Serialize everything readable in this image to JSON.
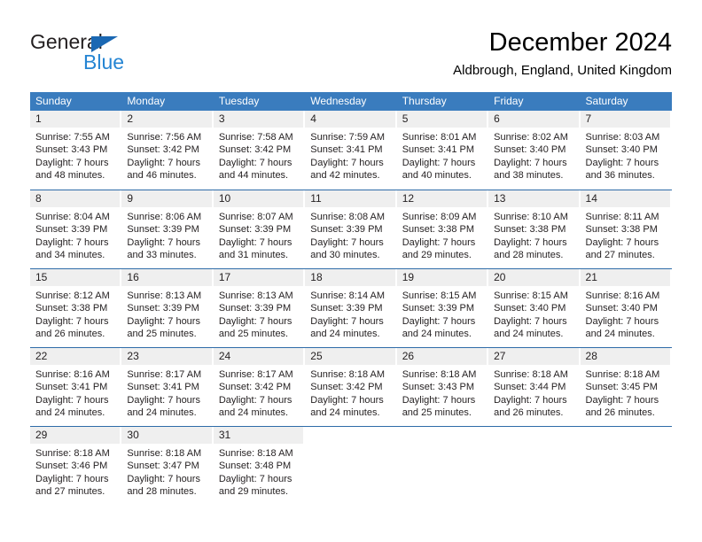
{
  "brand": {
    "name_top": "General",
    "name_bottom": "Blue",
    "color_dark": "#231f20",
    "color_blue": "#2585d3",
    "triangle_color": "#1b68b3"
  },
  "header": {
    "title": "December 2024",
    "location": "Aldbrough, England, United Kingdom"
  },
  "calendar": {
    "header_bg": "#3a7cbe",
    "day_band_bg": "#efefef",
    "weekdays": [
      "Sunday",
      "Monday",
      "Tuesday",
      "Wednesday",
      "Thursday",
      "Friday",
      "Saturday"
    ],
    "weeks": [
      [
        {
          "day": "1",
          "sunrise": "Sunrise: 7:55 AM",
          "sunset": "Sunset: 3:43 PM",
          "daylight_line1": "Daylight: 7 hours",
          "daylight_line2": "and 48 minutes."
        },
        {
          "day": "2",
          "sunrise": "Sunrise: 7:56 AM",
          "sunset": "Sunset: 3:42 PM",
          "daylight_line1": "Daylight: 7 hours",
          "daylight_line2": "and 46 minutes."
        },
        {
          "day": "3",
          "sunrise": "Sunrise: 7:58 AM",
          "sunset": "Sunset: 3:42 PM",
          "daylight_line1": "Daylight: 7 hours",
          "daylight_line2": "and 44 minutes."
        },
        {
          "day": "4",
          "sunrise": "Sunrise: 7:59 AM",
          "sunset": "Sunset: 3:41 PM",
          "daylight_line1": "Daylight: 7 hours",
          "daylight_line2": "and 42 minutes."
        },
        {
          "day": "5",
          "sunrise": "Sunrise: 8:01 AM",
          "sunset": "Sunset: 3:41 PM",
          "daylight_line1": "Daylight: 7 hours",
          "daylight_line2": "and 40 minutes."
        },
        {
          "day": "6",
          "sunrise": "Sunrise: 8:02 AM",
          "sunset": "Sunset: 3:40 PM",
          "daylight_line1": "Daylight: 7 hours",
          "daylight_line2": "and 38 minutes."
        },
        {
          "day": "7",
          "sunrise": "Sunrise: 8:03 AM",
          "sunset": "Sunset: 3:40 PM",
          "daylight_line1": "Daylight: 7 hours",
          "daylight_line2": "and 36 minutes."
        }
      ],
      [
        {
          "day": "8",
          "sunrise": "Sunrise: 8:04 AM",
          "sunset": "Sunset: 3:39 PM",
          "daylight_line1": "Daylight: 7 hours",
          "daylight_line2": "and 34 minutes."
        },
        {
          "day": "9",
          "sunrise": "Sunrise: 8:06 AM",
          "sunset": "Sunset: 3:39 PM",
          "daylight_line1": "Daylight: 7 hours",
          "daylight_line2": "and 33 minutes."
        },
        {
          "day": "10",
          "sunrise": "Sunrise: 8:07 AM",
          "sunset": "Sunset: 3:39 PM",
          "daylight_line1": "Daylight: 7 hours",
          "daylight_line2": "and 31 minutes."
        },
        {
          "day": "11",
          "sunrise": "Sunrise: 8:08 AM",
          "sunset": "Sunset: 3:39 PM",
          "daylight_line1": "Daylight: 7 hours",
          "daylight_line2": "and 30 minutes."
        },
        {
          "day": "12",
          "sunrise": "Sunrise: 8:09 AM",
          "sunset": "Sunset: 3:38 PM",
          "daylight_line1": "Daylight: 7 hours",
          "daylight_line2": "and 29 minutes."
        },
        {
          "day": "13",
          "sunrise": "Sunrise: 8:10 AM",
          "sunset": "Sunset: 3:38 PM",
          "daylight_line1": "Daylight: 7 hours",
          "daylight_line2": "and 28 minutes."
        },
        {
          "day": "14",
          "sunrise": "Sunrise: 8:11 AM",
          "sunset": "Sunset: 3:38 PM",
          "daylight_line1": "Daylight: 7 hours",
          "daylight_line2": "and 27 minutes."
        }
      ],
      [
        {
          "day": "15",
          "sunrise": "Sunrise: 8:12 AM",
          "sunset": "Sunset: 3:38 PM",
          "daylight_line1": "Daylight: 7 hours",
          "daylight_line2": "and 26 minutes."
        },
        {
          "day": "16",
          "sunrise": "Sunrise: 8:13 AM",
          "sunset": "Sunset: 3:39 PM",
          "daylight_line1": "Daylight: 7 hours",
          "daylight_line2": "and 25 minutes."
        },
        {
          "day": "17",
          "sunrise": "Sunrise: 8:13 AM",
          "sunset": "Sunset: 3:39 PM",
          "daylight_line1": "Daylight: 7 hours",
          "daylight_line2": "and 25 minutes."
        },
        {
          "day": "18",
          "sunrise": "Sunrise: 8:14 AM",
          "sunset": "Sunset: 3:39 PM",
          "daylight_line1": "Daylight: 7 hours",
          "daylight_line2": "and 24 minutes."
        },
        {
          "day": "19",
          "sunrise": "Sunrise: 8:15 AM",
          "sunset": "Sunset: 3:39 PM",
          "daylight_line1": "Daylight: 7 hours",
          "daylight_line2": "and 24 minutes."
        },
        {
          "day": "20",
          "sunrise": "Sunrise: 8:15 AM",
          "sunset": "Sunset: 3:40 PM",
          "daylight_line1": "Daylight: 7 hours",
          "daylight_line2": "and 24 minutes."
        },
        {
          "day": "21",
          "sunrise": "Sunrise: 8:16 AM",
          "sunset": "Sunset: 3:40 PM",
          "daylight_line1": "Daylight: 7 hours",
          "daylight_line2": "and 24 minutes."
        }
      ],
      [
        {
          "day": "22",
          "sunrise": "Sunrise: 8:16 AM",
          "sunset": "Sunset: 3:41 PM",
          "daylight_line1": "Daylight: 7 hours",
          "daylight_line2": "and 24 minutes."
        },
        {
          "day": "23",
          "sunrise": "Sunrise: 8:17 AM",
          "sunset": "Sunset: 3:41 PM",
          "daylight_line1": "Daylight: 7 hours",
          "daylight_line2": "and 24 minutes."
        },
        {
          "day": "24",
          "sunrise": "Sunrise: 8:17 AM",
          "sunset": "Sunset: 3:42 PM",
          "daylight_line1": "Daylight: 7 hours",
          "daylight_line2": "and 24 minutes."
        },
        {
          "day": "25",
          "sunrise": "Sunrise: 8:18 AM",
          "sunset": "Sunset: 3:42 PM",
          "daylight_line1": "Daylight: 7 hours",
          "daylight_line2": "and 24 minutes."
        },
        {
          "day": "26",
          "sunrise": "Sunrise: 8:18 AM",
          "sunset": "Sunset: 3:43 PM",
          "daylight_line1": "Daylight: 7 hours",
          "daylight_line2": "and 25 minutes."
        },
        {
          "day": "27",
          "sunrise": "Sunrise: 8:18 AM",
          "sunset": "Sunset: 3:44 PM",
          "daylight_line1": "Daylight: 7 hours",
          "daylight_line2": "and 26 minutes."
        },
        {
          "day": "28",
          "sunrise": "Sunrise: 8:18 AM",
          "sunset": "Sunset: 3:45 PM",
          "daylight_line1": "Daylight: 7 hours",
          "daylight_line2": "and 26 minutes."
        }
      ],
      [
        {
          "day": "29",
          "sunrise": "Sunrise: 8:18 AM",
          "sunset": "Sunset: 3:46 PM",
          "daylight_line1": "Daylight: 7 hours",
          "daylight_line2": "and 27 minutes."
        },
        {
          "day": "30",
          "sunrise": "Sunrise: 8:18 AM",
          "sunset": "Sunset: 3:47 PM",
          "daylight_line1": "Daylight: 7 hours",
          "daylight_line2": "and 28 minutes."
        },
        {
          "day": "31",
          "sunrise": "Sunrise: 8:18 AM",
          "sunset": "Sunset: 3:48 PM",
          "daylight_line1": "Daylight: 7 hours",
          "daylight_line2": "and 29 minutes."
        },
        {
          "day": "",
          "sunrise": "",
          "sunset": "",
          "daylight_line1": "",
          "daylight_line2": ""
        },
        {
          "day": "",
          "sunrise": "",
          "sunset": "",
          "daylight_line1": "",
          "daylight_line2": ""
        },
        {
          "day": "",
          "sunrise": "",
          "sunset": "",
          "daylight_line1": "",
          "daylight_line2": ""
        },
        {
          "day": "",
          "sunrise": "",
          "sunset": "",
          "daylight_line1": "",
          "daylight_line2": ""
        }
      ]
    ]
  }
}
